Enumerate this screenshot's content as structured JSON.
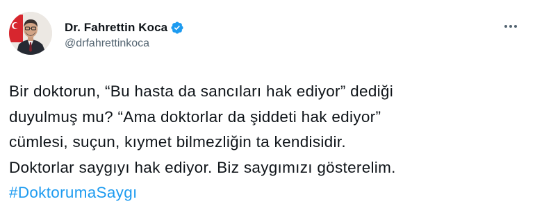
{
  "author": {
    "display_name": "Dr. Fahrettin Koca",
    "handle": "@drfahrettinkoca",
    "verified_icon": "verified-badge-icon"
  },
  "tweet": {
    "lines": [
      "Bir doktorun, “Bu hasta da sancıları hak ediyor” dediği",
      "duyulmuş mu? “Ama doktorlar da şiddeti hak ediyor”",
      "cümlesi, suçun, kıymet bilmezliğin ta kendisidir.",
      "Doktorlar saygıyı hak ediyor. Biz saygımızı gösterelim."
    ],
    "hashtag": "#DoktorumaSaygı"
  },
  "menu_icon": "more-options-icon",
  "colors": {
    "text": "#0f1419",
    "secondary": "#536471",
    "accent": "#1d9bf0"
  }
}
